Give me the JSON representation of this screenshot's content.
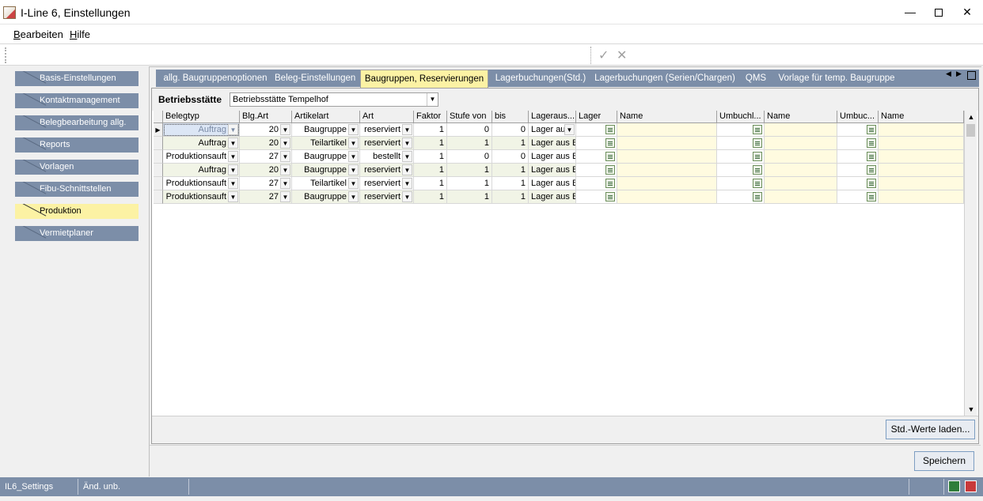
{
  "window": {
    "title": "I-Line 6, Einstellungen"
  },
  "menu": [
    {
      "label": "Bearbeiten",
      "accel": "B",
      "rest": "earbeiten"
    },
    {
      "label": "Hilfe",
      "accel": "H",
      "rest": "ilfe"
    }
  ],
  "sidebar": {
    "items": [
      {
        "label": "Basis-Einstellungen",
        "active": false
      },
      {
        "label": "Kontaktmanagement",
        "active": false
      },
      {
        "label": "Belegbearbeitung allg.",
        "active": false
      },
      {
        "label": "Reports",
        "active": false
      },
      {
        "label": "Vorlagen",
        "active": false
      },
      {
        "label": "Fibu-Schnittstellen",
        "active": false
      },
      {
        "label": "Produktion",
        "active": true
      },
      {
        "label": "Vermietplaner",
        "active": false
      }
    ]
  },
  "tabs": [
    {
      "label": "allg. Baugruppenoptionen",
      "active": false
    },
    {
      "label": "Beleg-Einstellungen",
      "active": false
    },
    {
      "label": "Baugruppen, Reservierungen",
      "active": true
    },
    {
      "label": "Lagerbuchungen(Std.)",
      "active": false
    },
    {
      "label": "Lagerbuchungen (Serien/Chargen)",
      "active": false
    },
    {
      "label": "QMS",
      "active": false
    },
    {
      "label": "Vorlage für temp. Baugruppe",
      "active": false
    }
  ],
  "filter": {
    "label": "Betriebsstätte",
    "value": "Betriebsstätte Tempelhof"
  },
  "grid": {
    "columns": [
      "Belegtyp",
      "Blg.Art",
      "Artikelart",
      "Art",
      "Faktor",
      "Stufe von",
      "bis",
      "Lageraus...",
      "Lager",
      "Name",
      "Umbuchl...",
      "Name",
      "Umbuc...",
      "Name"
    ],
    "rows": [
      {
        "belegtyp": "Auftrag",
        "blgart": "20",
        "artikelart": "Baugruppe",
        "art": "reserviert",
        "faktor": "1",
        "stufe_von": "0",
        "bis": "0",
        "lageraus": "Lager au"
      },
      {
        "belegtyp": "Auftrag",
        "blgart": "20",
        "artikelart": "Teilartikel",
        "art": "reserviert",
        "faktor": "1",
        "stufe_von": "1",
        "bis": "1",
        "lageraus": "Lager aus B"
      },
      {
        "belegtyp": "Produktionsauft",
        "blgart": "27",
        "artikelart": "Baugruppe",
        "art": "bestellt",
        "faktor": "1",
        "stufe_von": "0",
        "bis": "0",
        "lageraus": "Lager aus B"
      },
      {
        "belegtyp": "Auftrag",
        "blgart": "20",
        "artikelart": "Baugruppe",
        "art": "reserviert",
        "faktor": "1",
        "stufe_von": "1",
        "bis": "1",
        "lageraus": "Lager aus B"
      },
      {
        "belegtyp": "Produktionsauft",
        "blgart": "27",
        "artikelart": "Teilartikel",
        "art": "reserviert",
        "faktor": "1",
        "stufe_von": "1",
        "bis": "1",
        "lageraus": "Lager aus B"
      },
      {
        "belegtyp": "Produktionsauft",
        "blgart": "27",
        "artikelart": "Baugruppe",
        "art": "reserviert",
        "faktor": "1",
        "stufe_von": "1",
        "bis": "1",
        "lageraus": "Lager aus B"
      }
    ]
  },
  "buttons": {
    "std_werte": "Std.-Werte laden...",
    "speichern": "Speichern"
  },
  "statusbar": {
    "module": "IL6_Settings",
    "state": "Änd. unb."
  },
  "colors": {
    "accent_blue": "#7c8ea8",
    "active_yellow": "#fcf2a4",
    "row_alt": "#f1f4e6"
  }
}
